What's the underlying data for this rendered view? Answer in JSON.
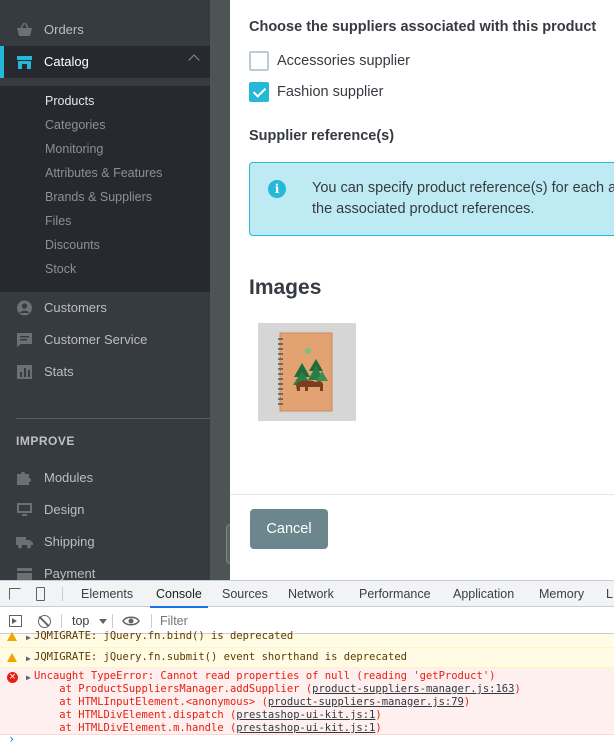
{
  "sidebar": {
    "items_top": [
      {
        "label": "Orders",
        "icon": "basket-icon"
      },
      {
        "label": "Catalog",
        "icon": "store-icon"
      }
    ],
    "catalog_sub": [
      "Products",
      "Categories",
      "Monitoring",
      "Attributes & Features",
      "Brands & Suppliers",
      "Files",
      "Discounts",
      "Stock"
    ],
    "items_mid": [
      {
        "label": "Customers",
        "icon": "user-icon"
      },
      {
        "label": "Customer Service",
        "icon": "chat-icon"
      },
      {
        "label": "Stats",
        "icon": "bar-chart-icon"
      }
    ],
    "section_improve": "IMPROVE",
    "items_bottom": [
      {
        "label": "Modules",
        "icon": "puzzle-icon"
      },
      {
        "label": "Design",
        "icon": "monitor-icon"
      },
      {
        "label": "Shipping",
        "icon": "truck-icon"
      },
      {
        "label": "Payment",
        "icon": "card-icon"
      }
    ]
  },
  "modal": {
    "suppliers_heading": "Choose the suppliers associated with this product",
    "suppliers": [
      {
        "label": "Accessories supplier",
        "checked": false
      },
      {
        "label": "Fashion supplier",
        "checked": true
      }
    ],
    "reference_heading": "Supplier reference(s)",
    "alert_line1": "You can specify product reference(s) for each a",
    "alert_line2": "the associated product references.",
    "images_heading": "Images",
    "thumbnail_icon": "notebook-bear-image",
    "cancel_label": "Cancel"
  },
  "devtools": {
    "tabs": [
      "Elements",
      "Console",
      "Sources",
      "Network",
      "Performance",
      "Application",
      "Memory",
      "L"
    ],
    "active_tab": "Console",
    "context": "top",
    "filter_placeholder": "Filter",
    "messages": [
      {
        "level": "warning",
        "text": "JQMIGRATE: jQuery.fn.bind() is deprecated"
      },
      {
        "level": "warning",
        "text": "JQMIGRATE: jQuery.fn.submit() event shorthand is deprecated"
      },
      {
        "level": "error",
        "text": "Uncaught TypeError: Cannot read properties of null (reading 'getProduct')",
        "stack": [
          {
            "prefix": "    at ProductSuppliersManager.addSupplier (",
            "link": "product-suppliers-manager.js:163",
            "suffix": ")"
          },
          {
            "prefix": "    at HTMLInputElement.<anonymous> (",
            "link": "product-suppliers-manager.js:79",
            "suffix": ")"
          },
          {
            "prefix": "    at HTMLDivElement.dispatch (",
            "link": "prestashop-ui-kit.js:1",
            "suffix": ")"
          },
          {
            "prefix": "    at HTMLDivElement.m.handle (",
            "link": "prestashop-ui-kit.js:1",
            "suffix": ")"
          }
        ]
      }
    ],
    "prompt": "›"
  },
  "colors": {
    "accent": "#25b9d7",
    "sidebar": "#363a41",
    "error": "#e52012"
  }
}
